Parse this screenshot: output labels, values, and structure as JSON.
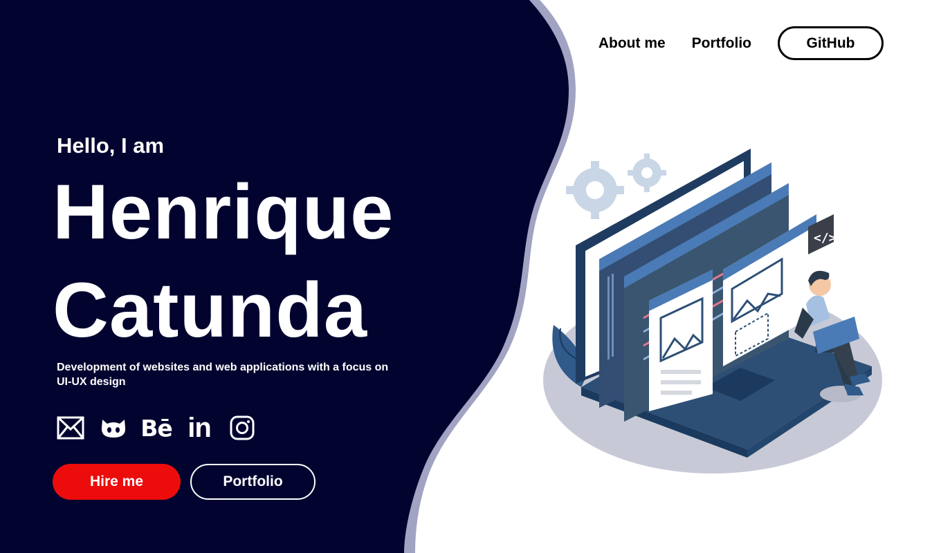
{
  "nav": {
    "about_label": "About me",
    "portfolio_label": "Portfolio",
    "github_label": "GitHub"
  },
  "hero": {
    "greeting": "Hello, I am",
    "first_name": "Henrique",
    "last_name": "Catunda",
    "tagline": "Development of websites and web applications with a focus on UI-UX design",
    "hire_label": "Hire me",
    "portfolio_label": "Portfolio"
  },
  "socials": {
    "behance_text": "Bē",
    "linkedin_text": "in",
    "icons": [
      "mail-icon",
      "github-icon",
      "behance-icon",
      "linkedin-icon",
      "instagram-icon"
    ]
  },
  "colors": {
    "panel": "#02042f",
    "wave_accent": "#a2a3c3",
    "hire_button": "#ec0c0c",
    "illustration_blue": "#2f5a8a",
    "illustration_light_blue": "#4a7bb7"
  }
}
